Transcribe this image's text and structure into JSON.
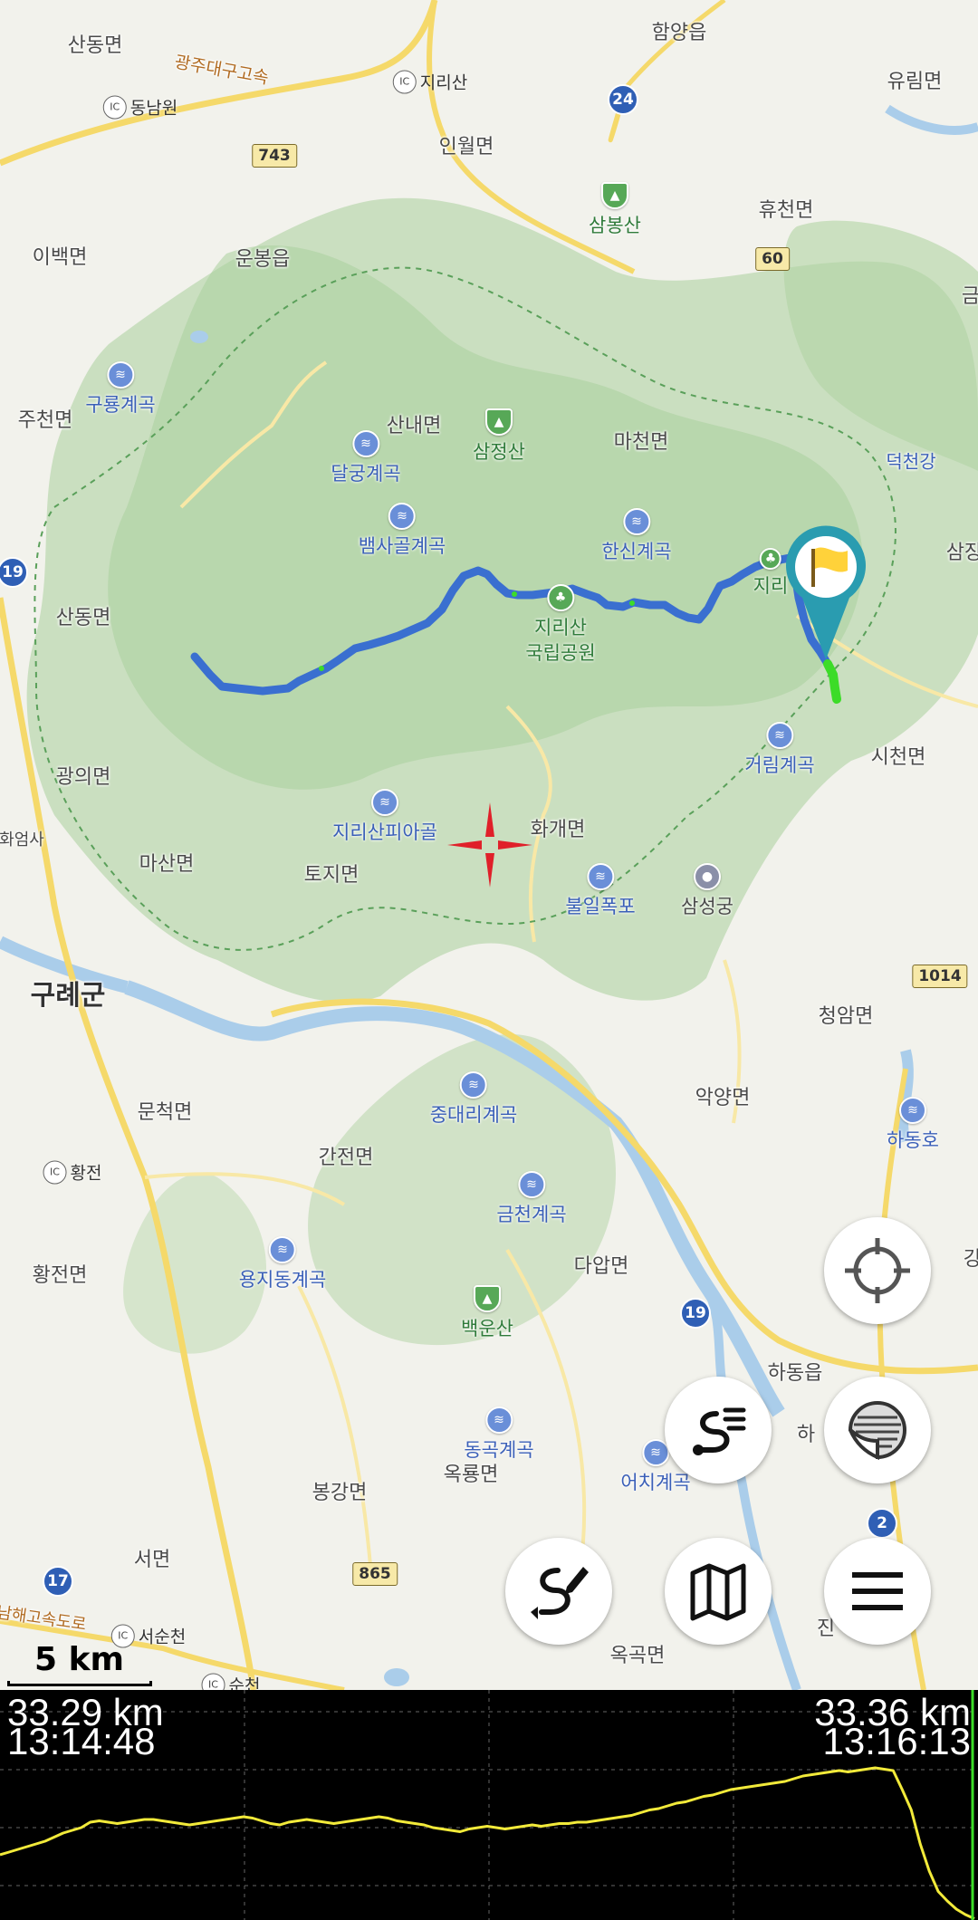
{
  "map": {
    "scale_label": "5 km",
    "labels": {
      "sandong1": "산동면",
      "gwangju_highway": "광주대구고속",
      "dongnamwon": "동남원",
      "jirisan_ic": "지리산",
      "hamyang": "함양읍",
      "yurim": "유림면",
      "inwol": "인월면",
      "ibaek": "이백면",
      "unbong": "운봉읍",
      "hyucheon": "휴천면",
      "jucheon": "주천면",
      "sannae": "산내면",
      "macheon": "마천면",
      "deokcheon": "덕천강",
      "sandong2": "산동면",
      "gwangui": "광의면",
      "masan": "마산면",
      "toji": "토지면",
      "hwagae": "화개면",
      "sicheon": "시천면",
      "guryegun": "구례군",
      "hwaeomsa": "화엄사",
      "cheongam": "청암면",
      "munchuk": "문척면",
      "akyang": "악양면",
      "ganjeon": "간전면",
      "hwangjeon": "황전면",
      "dapmyeon": "다압면",
      "hadong_eup": "하동읍",
      "hadong_short": "하",
      "bonggang": "봉강면",
      "okryong": "옥룡면",
      "seomyeon": "서면",
      "okgok": "옥곡면",
      "jingyo": "진",
      "namhae_highway": "남해고속도로",
      "seosuncheon": "서순천",
      "suncheon": "순천",
      "hwangjeon_ic": "황전",
      "samjang": "삼장",
      "geum": "금",
      "gangseo": "강"
    },
    "pois": {
      "sambongsan": "삼봉산",
      "guryong": "구룡계곡",
      "samjeongsan": "삼정산",
      "dalgung": "달궁계곡",
      "baemsagol": "뱀사골계곡",
      "hansin": "한신계곡",
      "jirisan_park_1": "지리산",
      "jirisan_park_2": "국립공원",
      "jiri_peak": "지리",
      "georim": "거림계곡",
      "piagol": "지리산피아골",
      "buril": "불일폭포",
      "samseong": "삼성궁",
      "hadongho": "하동호",
      "jungdaeri": "중대리계곡",
      "geumcheon": "금천계곡",
      "yongjidong": "용지동계곡",
      "baekunsan": "백운산",
      "donggok": "동곡계곡",
      "eochi": "어치계곡"
    },
    "route_shields": {
      "r24": "24",
      "r743": "743",
      "r60": "60",
      "r19a": "19",
      "r19b": "19",
      "r1014": "1014",
      "r865": "865",
      "r17": "17",
      "r2": "2"
    },
    "interchange_icon_text": "IC",
    "colors": {
      "track": "#3a6fd0",
      "track_highlight": "#3cdc28",
      "pin": "#2a9cb0",
      "flag": "#ffd23a",
      "crosshair": "#e0202a",
      "forest": "#b7d6ad",
      "water": "#aacdea"
    }
  },
  "controls": {
    "locate": "crosshair-locate-icon",
    "route_list": "route-list-icon",
    "layers": "layers-icon",
    "draw_route": "draw-route-icon",
    "maps": "map-icon",
    "menu": "menu-icon"
  },
  "elevation": {
    "left_distance": "33.29 km",
    "left_time": "13:14:48",
    "right_distance": "33.36 km",
    "right_time": "13:16:13",
    "line_color": "#f2ea3a",
    "profile": [
      28,
      26,
      24,
      22,
      20,
      18,
      15,
      12,
      10,
      8,
      4,
      3,
      4,
      5,
      4,
      3,
      2,
      2,
      3,
      4,
      5,
      6,
      5,
      4,
      3,
      2,
      1,
      0,
      1,
      3,
      5,
      6,
      4,
      3,
      2,
      3,
      4,
      5,
      4,
      3,
      2,
      1,
      0,
      1,
      3,
      4,
      5,
      6,
      8,
      9,
      10,
      11,
      9,
      8,
      7,
      8,
      9,
      8,
      7,
      6,
      7,
      6,
      5,
      5,
      4,
      4,
      3,
      2,
      1,
      0,
      -1,
      -3,
      -5,
      -6,
      -8,
      -10,
      -11,
      -13,
      -15,
      -16,
      -18,
      -20,
      -21,
      -22,
      -23,
      -24,
      -25,
      -26,
      -28,
      -30,
      -31,
      -32,
      -33,
      -34,
      -33,
      -34,
      -35,
      -36,
      -35,
      -34,
      -20,
      -5,
      20,
      40,
      55,
      62,
      68,
      72,
      75
    ]
  }
}
